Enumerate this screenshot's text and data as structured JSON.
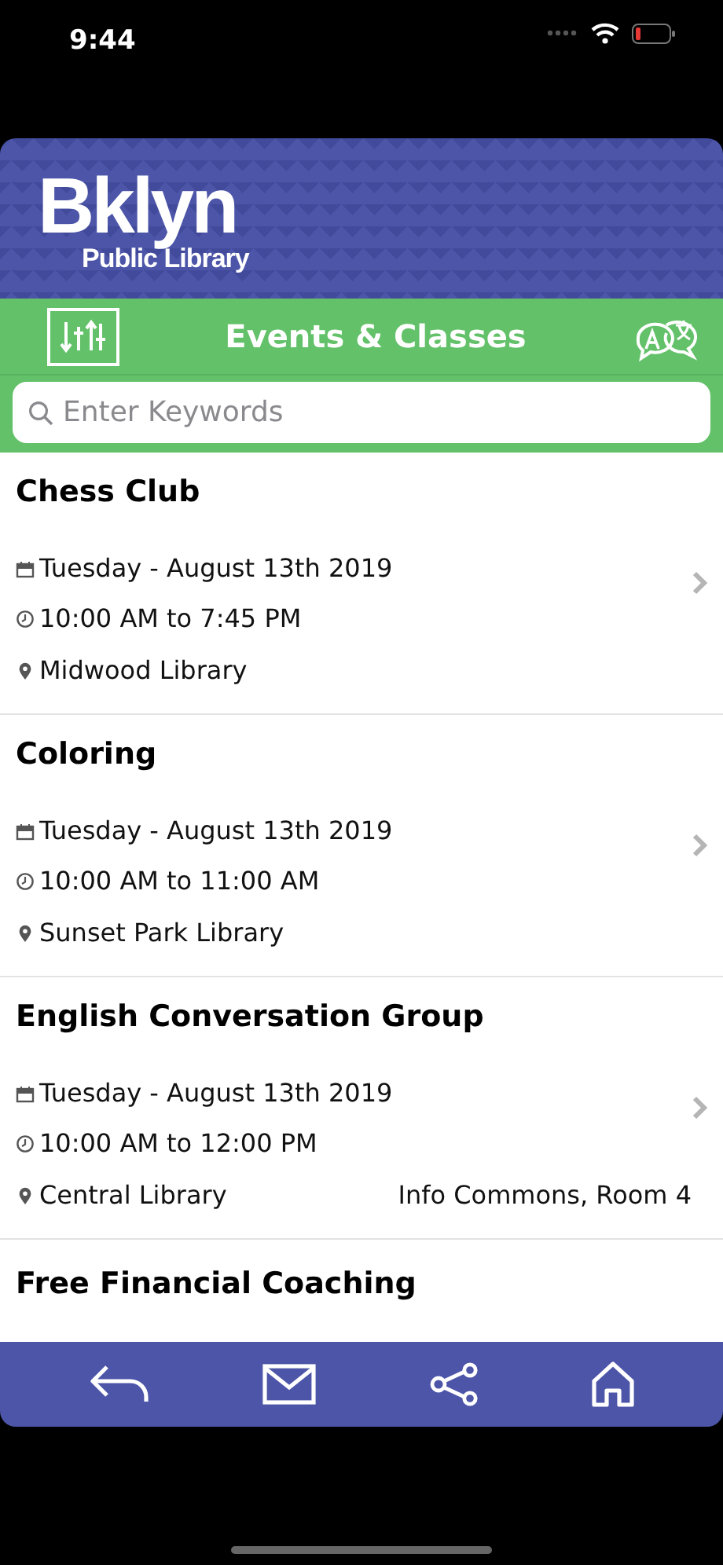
{
  "status_bar": {
    "time": "9:44"
  },
  "logo": {
    "wordmark": "Bklyn",
    "subtitle": "Public Library"
  },
  "toolbar": {
    "title": "Events & Classes"
  },
  "search": {
    "placeholder": "Enter Keywords"
  },
  "events": [
    {
      "title": "Chess Club",
      "date": "Tuesday - August 13th 2019",
      "time": "10:00 AM to 7:45 PM",
      "location": "Midwood Library"
    },
    {
      "title": "Coloring",
      "date": "Tuesday - August 13th 2019",
      "time": "10:00 AM to 11:00 AM",
      "location": "Sunset Park Library"
    },
    {
      "title": "English Conversation Group",
      "date": "Tuesday - August 13th 2019",
      "time": "10:00 AM to 12:00 PM",
      "location": "Central Library",
      "room": "Info Commons, Room 4"
    },
    {
      "title": "Free Financial Coaching"
    }
  ],
  "bottom_bar": [
    {
      "kind": "back"
    },
    {
      "kind": "mail"
    },
    {
      "kind": "share"
    },
    {
      "kind": "home"
    }
  ]
}
